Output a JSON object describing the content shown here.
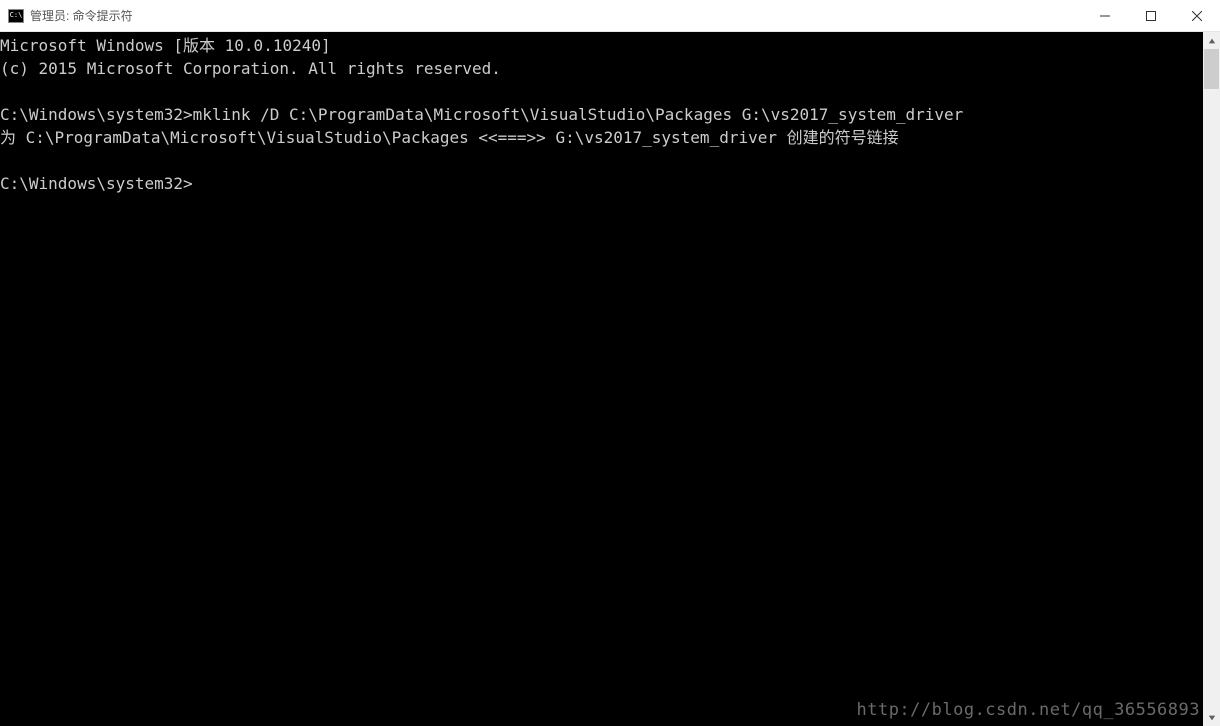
{
  "titlebar": {
    "icon_text": "C:\\",
    "title": "管理员: 命令提示符"
  },
  "terminal": {
    "lines": [
      "Microsoft Windows [版本 10.0.10240]",
      "(c) 2015 Microsoft Corporation. All rights reserved.",
      "",
      "C:\\Windows\\system32>mklink /D C:\\ProgramData\\Microsoft\\VisualStudio\\Packages G:\\vs2017_system_driver",
      "为 C:\\ProgramData\\Microsoft\\VisualStudio\\Packages <<===>> G:\\vs2017_system_driver 创建的符号链接",
      "",
      "C:\\Windows\\system32>"
    ]
  },
  "watermark": "http://blog.csdn.net/qq_36556893"
}
